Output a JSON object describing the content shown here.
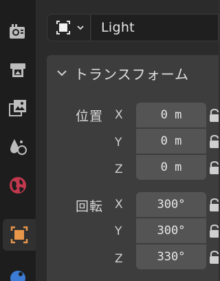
{
  "header": {
    "object_type_icon": "light-object-icon",
    "object_name": "Light"
  },
  "sidebar": {
    "tabs": [
      {
        "icon": "render-tab-icon"
      },
      {
        "icon": "output-tab-icon"
      },
      {
        "icon": "view-layer-tab-icon"
      },
      {
        "icon": "scene-tab-icon"
      },
      {
        "icon": "world-tab-icon"
      },
      {
        "icon": "object-tab-icon",
        "active": true
      },
      {
        "icon": "physics-tab-icon"
      }
    ]
  },
  "panel": {
    "title": "トランスフォーム",
    "location": {
      "label": "位置",
      "axes": [
        {
          "axis": "X",
          "value": "0 m"
        },
        {
          "axis": "Y",
          "value": "0 m"
        },
        {
          "axis": "Z",
          "value": "0 m"
        }
      ]
    },
    "rotation": {
      "label": "回転",
      "axes": [
        {
          "axis": "X",
          "value": "300°"
        },
        {
          "axis": "Y",
          "value": "300°"
        },
        {
          "axis": "Z",
          "value": "330°"
        }
      ]
    }
  },
  "colors": {
    "accent_orange": "#e8964a",
    "active_tab_bg": "#303030",
    "panel_bg": "#3d3d3d",
    "field_bg": "#545454"
  }
}
